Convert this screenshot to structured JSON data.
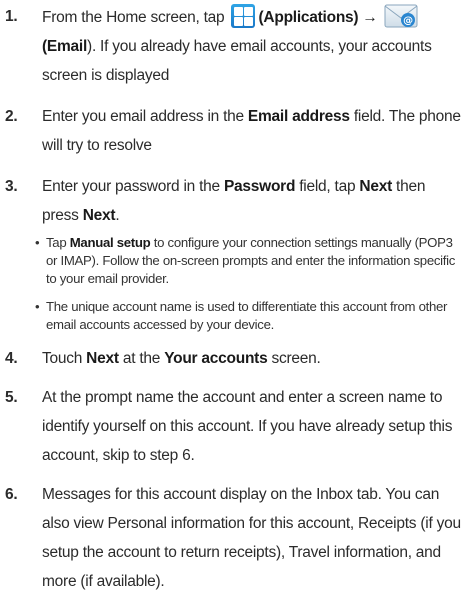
{
  "steps": [
    {
      "number": "1.",
      "prefix": "From the Home screen, tap",
      "app_open_paren": "(",
      "app_label": "Applications",
      "app_close": ")",
      "arrow": "→",
      "email_open_paren": "(",
      "email_label": "Email",
      "rest": "). If you already have email accounts, your accounts screen is displayed"
    },
    {
      "number": "2.",
      "t1": "Enter you email address in the ",
      "b1": "Email address",
      "t2": " field. The phone will try to resolve"
    },
    {
      "number": "3.",
      "t1": "Enter your password in the ",
      "b1": "Password",
      "t2": " field, tap ",
      "b2": "Next",
      "t3": " then press ",
      "b3": "Next",
      "t4": "."
    },
    {
      "number": "4.",
      "t1": "Touch ",
      "b1": "Next",
      "t2": " at the ",
      "b2": "Your accounts",
      "t3": " screen."
    },
    {
      "number": "5.",
      "text": "At the prompt name the account and enter a screen name to identify yourself on this account. If you have already setup this account, skip to step 6."
    },
    {
      "number": "6.",
      "text": "Messages for this account display on the Inbox tab. You can also view Personal information for this account, Receipts (if you setup the account to return receipts), Travel information, and more (if available)."
    }
  ],
  "bullets": [
    {
      "t1": "Tap ",
      "b1": "Manual setup",
      "t2": " to configure your connection settings manually (POP3 or IMAP). Follow the on-screen prompts and enter the information specific to your email provider."
    },
    {
      "text": "The unique account name is used to differentiate this account from other email accounts accessed by your device."
    }
  ],
  "icons": {
    "applications": "applications-grid-icon",
    "email": "email-envelope-icon",
    "applications_color": "#1f8ad6",
    "email_accent": "#2a86d0"
  }
}
